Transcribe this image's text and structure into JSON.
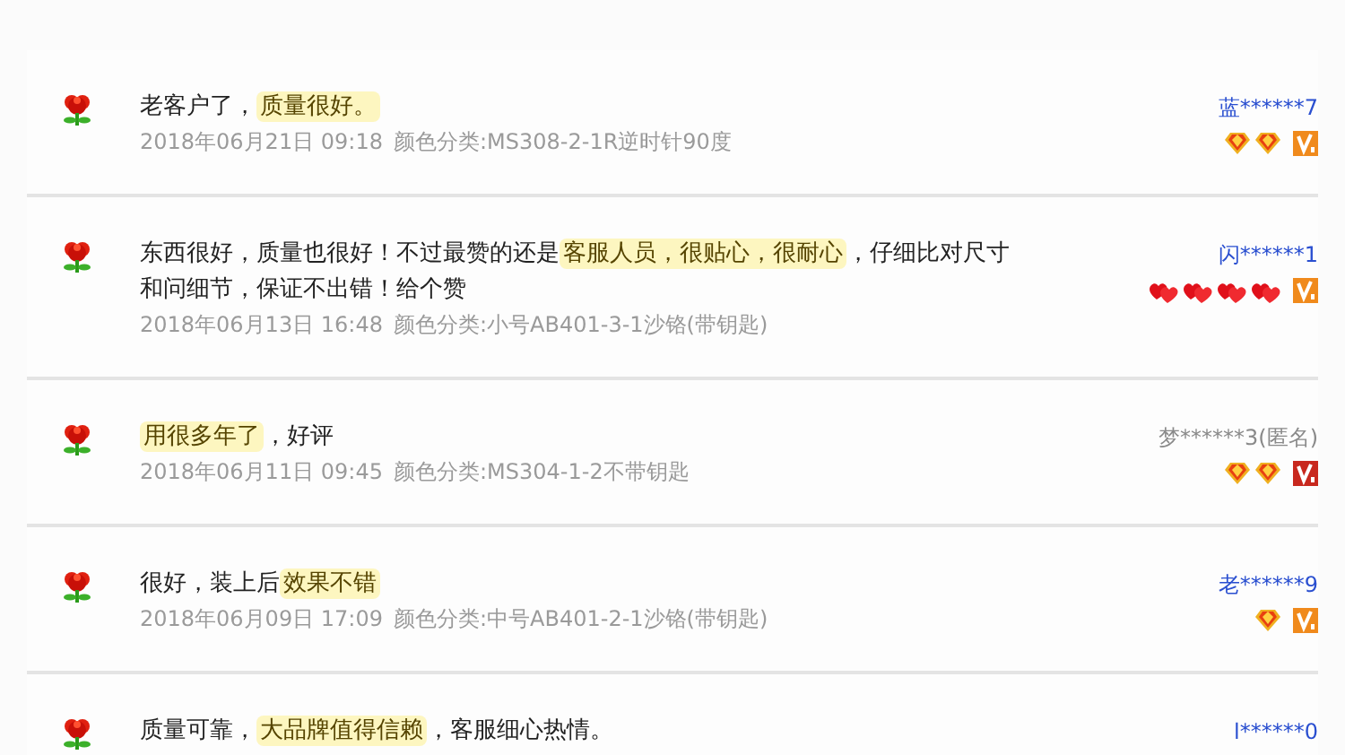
{
  "reviews": [
    {
      "comment": [
        {
          "text": "老客户了，",
          "highlighted": false
        },
        {
          "text": "质量很好。",
          "highlighted": true
        }
      ],
      "date": "2018年06月21日 09:18",
      "sku": "颜色分类:MS308-2-1R逆时针90度",
      "user": "蓝******7",
      "anonymous": false,
      "badges": [
        {
          "kind": "diamond"
        },
        {
          "kind": "diamond"
        },
        {
          "kind": "vip",
          "color": "#f08a1c"
        }
      ]
    },
    {
      "comment": [
        {
          "text": "东西很好，质量也很好！不过最赞的还是",
          "highlighted": false
        },
        {
          "text": "客服人员，很贴心，很耐心",
          "highlighted": true
        },
        {
          "text": "，仔细比对尺寸和问细节，保证不出错！给个赞",
          "highlighted": false
        }
      ],
      "date": "2018年06月13日 16:48",
      "sku": "颜色分类:小号AB401-3-1沙铬(带钥匙)",
      "user": "闪******1",
      "anonymous": false,
      "badges": [
        {
          "kind": "heart"
        },
        {
          "kind": "heart"
        },
        {
          "kind": "heart"
        },
        {
          "kind": "heart"
        },
        {
          "kind": "vip",
          "color": "#f08a1c"
        }
      ]
    },
    {
      "comment": [
        {
          "text": "用很多年了",
          "highlighted": true
        },
        {
          "text": "，好评",
          "highlighted": false
        }
      ],
      "date": "2018年06月11日 09:45",
      "sku": "颜色分类:MS304-1-2不带钥匙",
      "user": "梦******3(匿名)",
      "anonymous": true,
      "badges": [
        {
          "kind": "diamond"
        },
        {
          "kind": "diamond"
        },
        {
          "kind": "vip",
          "color": "#c8281e"
        }
      ]
    },
    {
      "comment": [
        {
          "text": "很好，装上后",
          "highlighted": false
        },
        {
          "text": "效果不错",
          "highlighted": true
        }
      ],
      "date": "2018年06月09日 17:09",
      "sku": "颜色分类:中号AB401-2-1沙铬(带钥匙)",
      "user": "老******9",
      "anonymous": false,
      "badges": [
        {
          "kind": "diamond"
        },
        {
          "kind": "vip",
          "color": "#f08a1c"
        }
      ]
    },
    {
      "comment": [
        {
          "text": "质量可靠，",
          "highlighted": false
        },
        {
          "text": "大品牌值得信赖",
          "highlighted": true
        },
        {
          "text": "，客服细心热情。",
          "highlighted": false
        }
      ],
      "user": "l******0",
      "anonymous": false
    }
  ]
}
